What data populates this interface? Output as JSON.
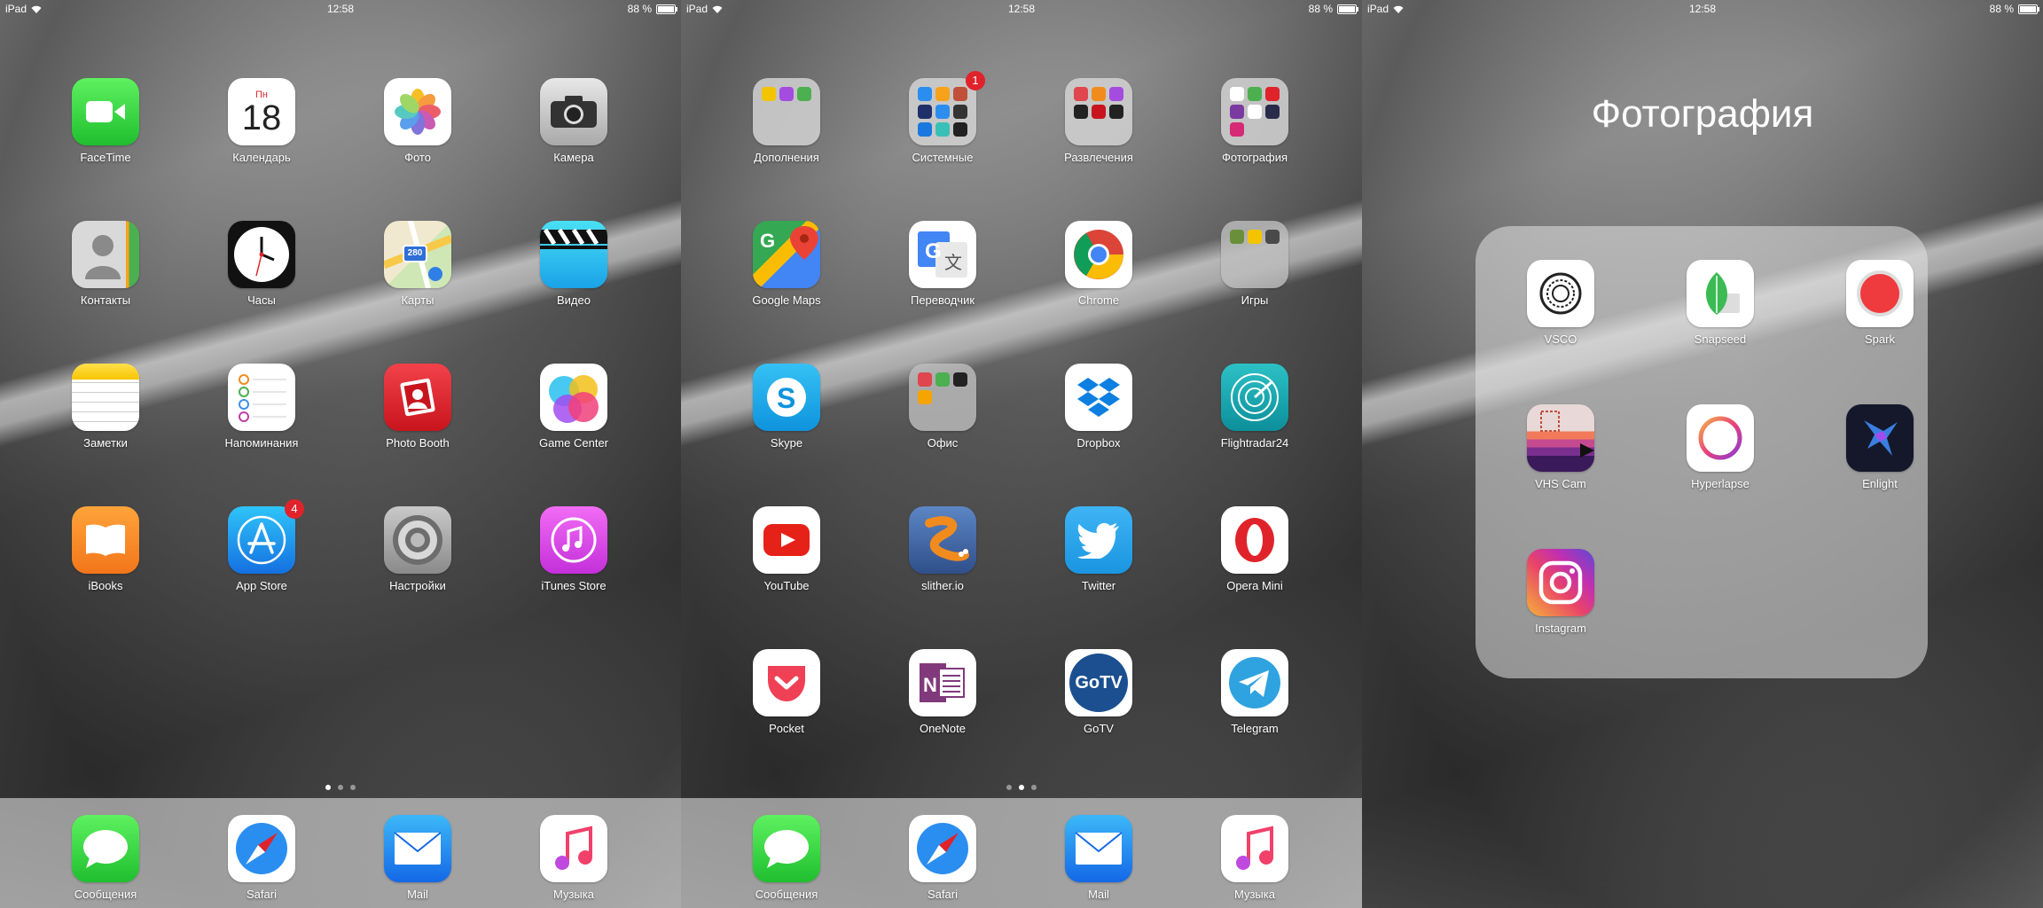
{
  "status": {
    "device": "iPad",
    "time": "12:58",
    "battery": "88 %",
    "battery_level": 0.88
  },
  "screen1": {
    "apps": [
      {
        "label": "FaceTime",
        "icon": "facetime-icon",
        "color": "#2ecc40"
      },
      {
        "label": "Календарь",
        "icon": "calendar-icon",
        "day": "Пн",
        "date": "18"
      },
      {
        "label": "Фото",
        "icon": "photos-icon"
      },
      {
        "label": "Камера",
        "icon": "camera-icon"
      },
      {
        "label": "Контакты",
        "icon": "contacts-icon"
      },
      {
        "label": "Часы",
        "icon": "clock-icon"
      },
      {
        "label": "Карты",
        "icon": "maps-icon",
        "road": "280"
      },
      {
        "label": "Видео",
        "icon": "video-icon"
      },
      {
        "label": "Заметки",
        "icon": "notes-icon"
      },
      {
        "label": "Напоминания",
        "icon": "reminders-icon"
      },
      {
        "label": "Photo Booth",
        "icon": "photobooth-icon"
      },
      {
        "label": "Game Center",
        "icon": "gamecenter-icon"
      },
      {
        "label": "iBooks",
        "icon": "ibooks-icon"
      },
      {
        "label": "App Store",
        "icon": "appstore-icon",
        "badge": "4"
      },
      {
        "label": "Настройки",
        "icon": "settings-icon"
      },
      {
        "label": "iTunes Store",
        "icon": "itunes-icon"
      }
    ],
    "dock": [
      {
        "label": "Сообщения",
        "icon": "messages-icon"
      },
      {
        "label": "Safari",
        "icon": "safari-icon"
      },
      {
        "label": "Mail",
        "icon": "mail-icon"
      },
      {
        "label": "Музыка",
        "icon": "music-icon"
      }
    ],
    "page_index": 0,
    "page_count": 3
  },
  "screen2": {
    "apps": [
      {
        "label": "Дополнения",
        "icon": "folder-icon"
      },
      {
        "label": "Системные",
        "icon": "folder-icon",
        "badge": "1"
      },
      {
        "label": "Развлечения",
        "icon": "folder-icon"
      },
      {
        "label": "Фотография",
        "icon": "folder-icon"
      },
      {
        "label": "Google Maps",
        "icon": "googlemaps-icon"
      },
      {
        "label": "Переводчик",
        "icon": "translate-icon"
      },
      {
        "label": "Chrome",
        "icon": "chrome-icon"
      },
      {
        "label": "Игры",
        "icon": "folder-icon"
      },
      {
        "label": "Skype",
        "icon": "skype-icon"
      },
      {
        "label": "Офис",
        "icon": "folder-icon"
      },
      {
        "label": "Dropbox",
        "icon": "dropbox-icon"
      },
      {
        "label": "Flightradar24",
        "icon": "flightradar-icon"
      },
      {
        "label": "YouTube",
        "icon": "youtube-icon"
      },
      {
        "label": "slither.io",
        "icon": "slither-icon"
      },
      {
        "label": "Twitter",
        "icon": "twitter-icon"
      },
      {
        "label": "Opera Mini",
        "icon": "opera-icon"
      },
      {
        "label": "Pocket",
        "icon": "pocket-icon"
      },
      {
        "label": "OneNote",
        "icon": "onenote-icon"
      },
      {
        "label": "GoTV",
        "icon": "gotv-icon",
        "text": "GoTV"
      },
      {
        "label": "Telegram",
        "icon": "telegram-icon"
      }
    ],
    "dock": [
      {
        "label": "Сообщения",
        "icon": "messages-icon"
      },
      {
        "label": "Safari",
        "icon": "safari-icon"
      },
      {
        "label": "Mail",
        "icon": "mail-icon"
      },
      {
        "label": "Музыка",
        "icon": "music-icon"
      }
    ],
    "page_index": 1,
    "page_count": 3
  },
  "screen3": {
    "folder_title": "Фотография",
    "apps": [
      {
        "label": "VSCO",
        "icon": "vsco-icon"
      },
      {
        "label": "Snapseed",
        "icon": "snapseed-icon"
      },
      {
        "label": "Spark",
        "icon": "spark-icon"
      },
      {
        "label": "VHS Cam",
        "icon": "vhscam-icon"
      },
      {
        "label": "Hyperlapse",
        "icon": "hyperlapse-icon"
      },
      {
        "label": "Enlight",
        "icon": "enlight-icon"
      },
      {
        "label": "Instagram",
        "icon": "instagram-icon"
      }
    ]
  }
}
